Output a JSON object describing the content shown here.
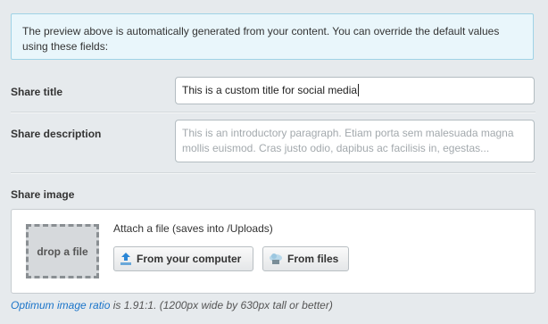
{
  "notice": {
    "text": "The preview above is automatically generated from your content. You can override the default values using these fields:"
  },
  "share_title": {
    "label": "Share title",
    "value": "This is a custom title for social media"
  },
  "share_description": {
    "label": "Share description",
    "placeholder": "This is an introductory paragraph. Etiam porta sem malesuada magna mollis euismod. Cras justo odio, dapibus ac facilisis in, egestas..."
  },
  "share_image": {
    "label": "Share image",
    "drop_label": "drop a file",
    "attach_text": "Attach a file (saves into /Uploads)",
    "btn_computer": "From your computer",
    "btn_files": "From files"
  },
  "hint": {
    "link": "Optimum image ratio",
    "text": " is 1.91:1. (1200px wide by 630px tall or better)"
  },
  "icons": {
    "computer": "upload-icon",
    "files": "cloud-files-icon"
  },
  "colors": {
    "link": "#1a74c9",
    "notice_bg": "#e9f6fb",
    "page_bg": "#e6eaed"
  }
}
